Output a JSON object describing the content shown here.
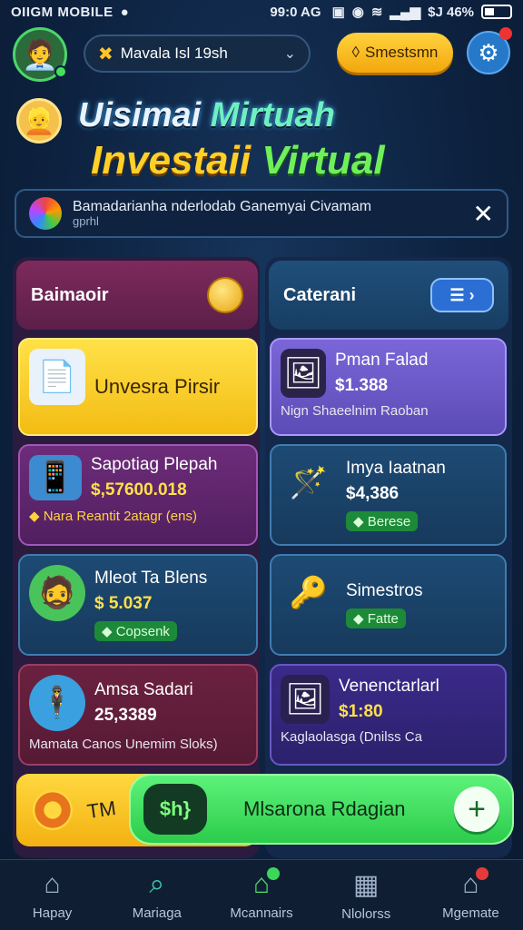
{
  "status_bar": {
    "carrier": "OIIGM MOBILE",
    "time": "99:0 AG",
    "battery": "$J 46%"
  },
  "header": {
    "search_label": "Mavala Isl 19sh",
    "session_label": "Smestsmn"
  },
  "title": {
    "line1_a": "Uisimai ",
    "line1_b": "Mirtuah",
    "line2_a": "Investaii ",
    "line2_b": "Virtual"
  },
  "banner": {
    "text": "Bamadarianha nderlodab Ganemyai Civamam",
    "subtext": "gprhl"
  },
  "left_column": {
    "title": "Baimaoir",
    "cards": [
      {
        "name": "Unvesra Pirsir"
      },
      {
        "name": "Sapotiag Plepah",
        "price": "$,57600.018",
        "note": "Nara Reantit 2atagr (ens)"
      },
      {
        "name": "Mleot Ta Blens",
        "price": "$ 5.037",
        "tag": "Copsenk"
      },
      {
        "name": "Amsa Sadari",
        "price": "25,3389",
        "note": "Mamata Canos Unemim Sloks)"
      }
    ]
  },
  "right_column": {
    "title": "Caterani",
    "cards": [
      {
        "name": "Pman Falad",
        "price": "$1.388",
        "note": "Nign Shaeelnim Raoban"
      },
      {
        "name": "Imya Iaatnan",
        "price": "$4,386",
        "tag": "Berese"
      },
      {
        "name": "Simestros",
        "tag": "Fatte"
      },
      {
        "name": "Venenctarlarl",
        "price": "$1:80",
        "note": "Kaglaolasga (Dnilss Ca"
      }
    ]
  },
  "bottom": {
    "tm_text": "TM",
    "dollar_text": "$h}",
    "action_label": "Mlsarona Rdagian"
  },
  "tabbar": [
    {
      "label": "Hapay",
      "icon": "home-icon"
    },
    {
      "label": "Mariaga",
      "icon": "search-icon"
    },
    {
      "label": "Mcannairs",
      "icon": "house-active-icon"
    },
    {
      "label": "Nlolorss",
      "icon": "profile-icon"
    },
    {
      "label": "Mgemate",
      "icon": "market-icon"
    }
  ],
  "colors": {
    "accent_green": "#45e05a",
    "accent_yellow": "#ffd23f",
    "background": "#0d2240"
  }
}
